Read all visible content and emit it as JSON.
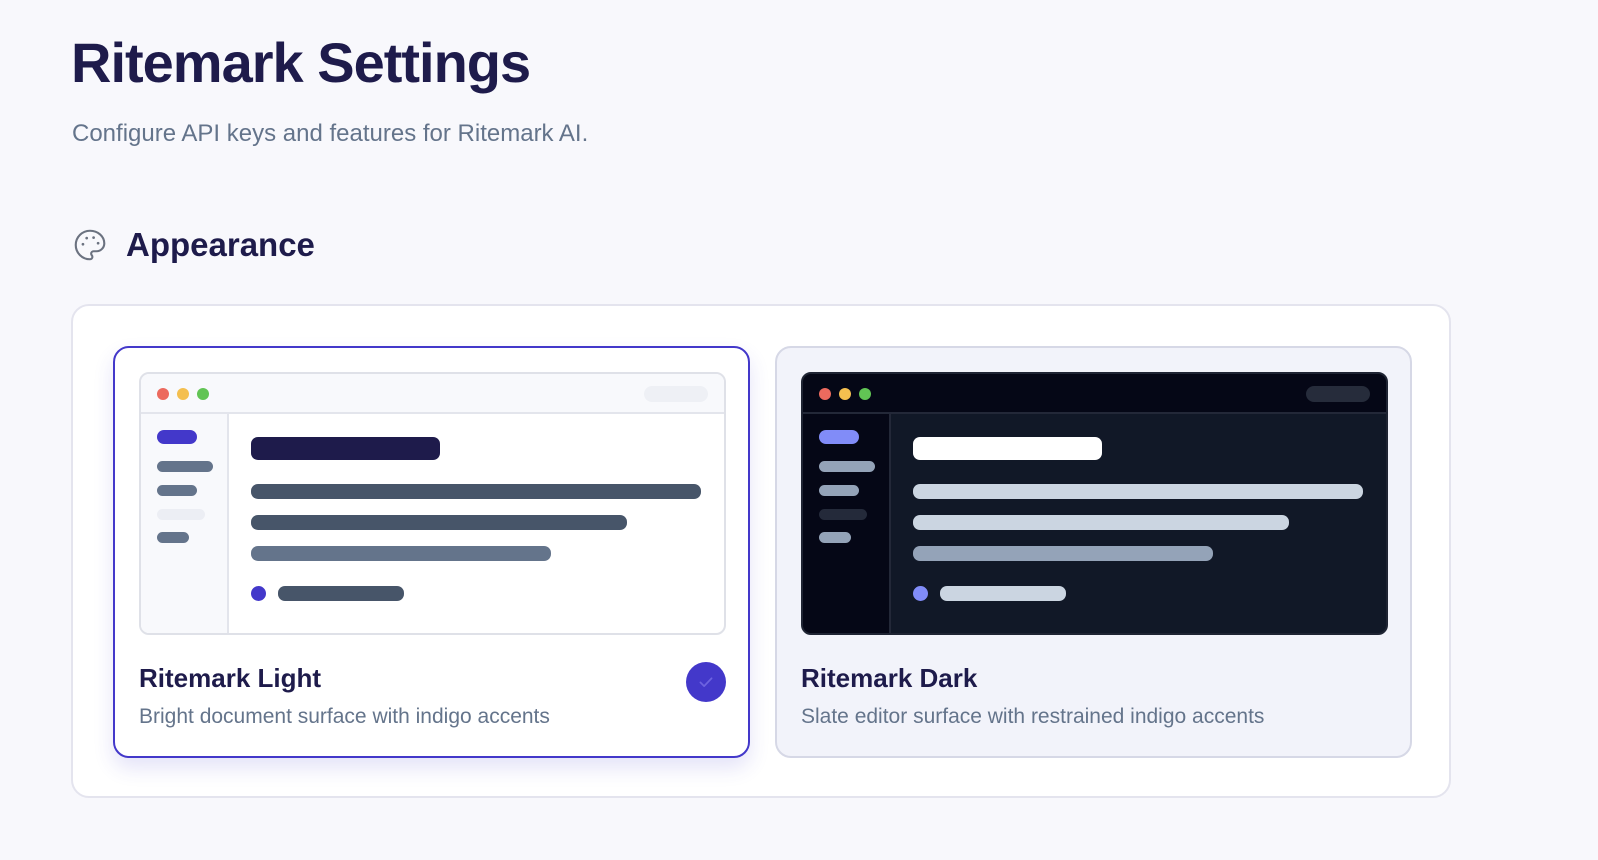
{
  "header": {
    "title": "Ritemark Settings",
    "subtitle": "Configure API keys and features for Ritemark AI."
  },
  "appearance": {
    "section_title": "Appearance",
    "section_icon": "palette-icon",
    "selected_theme": "ritemark-light",
    "themes": [
      {
        "id": "ritemark-light",
        "name": "Ritemark Light",
        "description": "Bright document surface with indigo accents",
        "selected": true
      },
      {
        "id": "ritemark-dark",
        "name": "Ritemark Dark",
        "description": "Slate editor surface with restrained indigo accents",
        "selected": false
      }
    ]
  },
  "colors": {
    "accent": "#4338ca",
    "title_text": "#1e1b4b",
    "muted_text": "#64748b",
    "page_background": "#f8f8fc",
    "dark_surface": "#111827"
  }
}
